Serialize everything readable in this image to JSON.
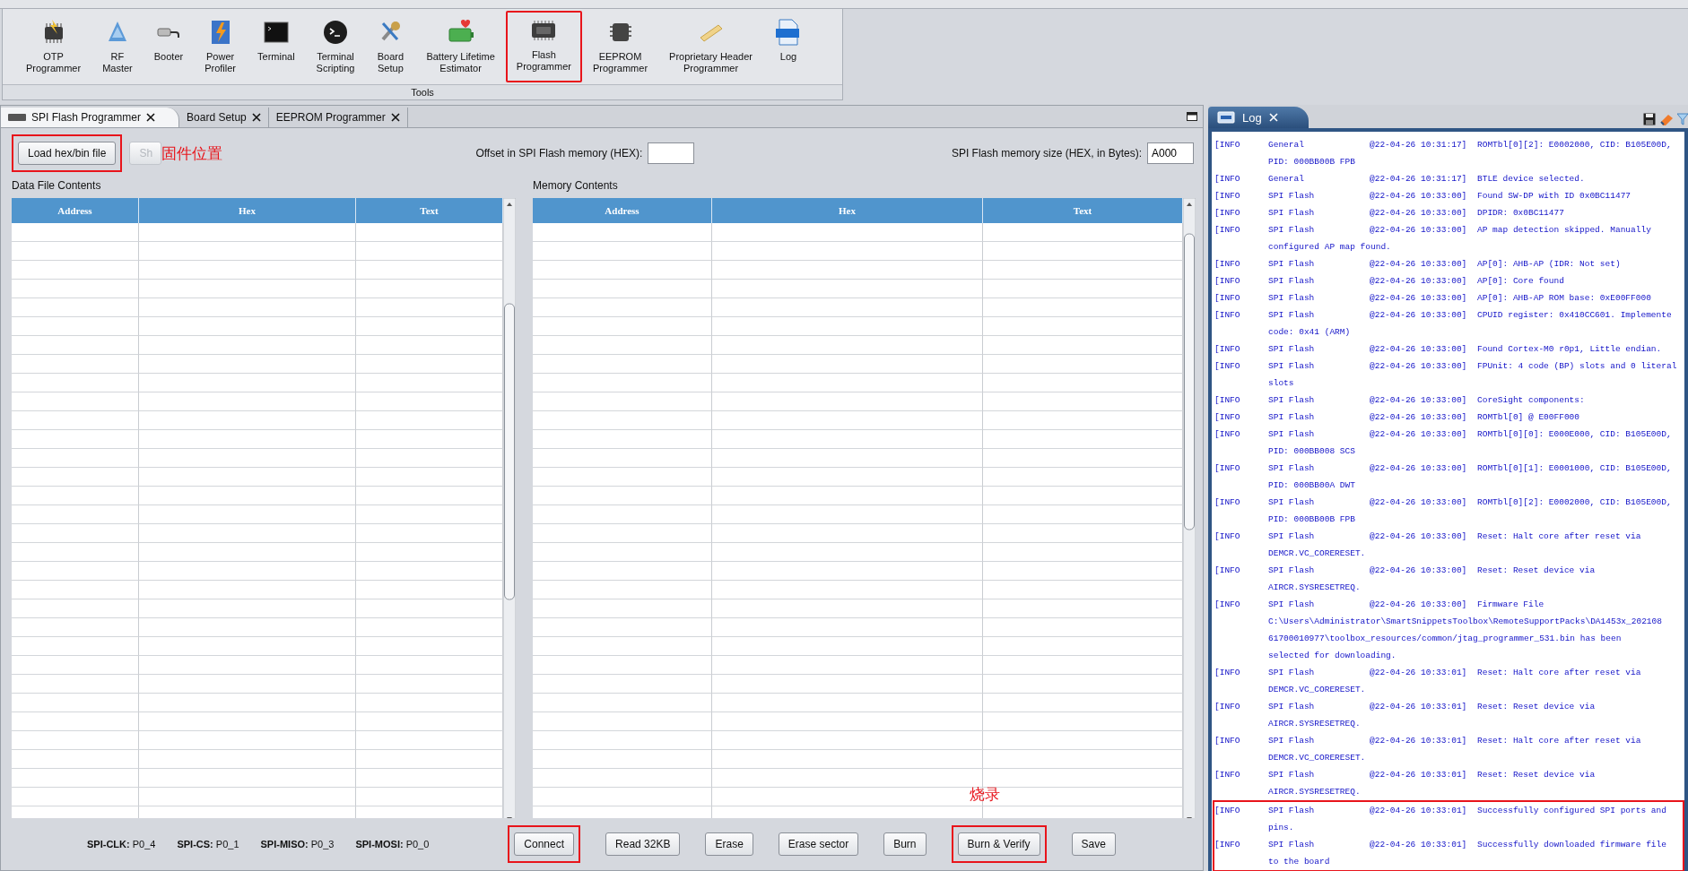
{
  "ribbon": {
    "items": [
      {
        "label": "OTP\nProgrammer",
        "highlighted": false
      },
      {
        "label": "RF\nMaster",
        "highlighted": false
      },
      {
        "label": "Booter",
        "highlighted": false
      },
      {
        "label": "Power\nProfiler",
        "highlighted": false
      },
      {
        "label": "Terminal",
        "highlighted": false
      },
      {
        "label": "Terminal\nScripting",
        "highlighted": false
      },
      {
        "label": "Board\nSetup",
        "highlighted": false
      },
      {
        "label": "Battery Lifetime\nEstimator",
        "highlighted": false
      },
      {
        "label": "Flash\nProgrammer",
        "highlighted": true
      },
      {
        "label": "EEPROM\nProgrammer",
        "highlighted": false
      },
      {
        "label": "Proprietary Header\nProgrammer",
        "highlighted": false
      },
      {
        "label": "Log",
        "highlighted": false
      }
    ],
    "caption": "Tools"
  },
  "tabs": [
    {
      "label": "SPI Flash Programmer",
      "selected": true
    },
    {
      "label": "Board Setup",
      "selected": false
    },
    {
      "label": "EEPROM Programmer",
      "selected": false
    }
  ],
  "load_button": {
    "label": "Load hex/bin file",
    "highlighted": true
  },
  "hidden_button": {
    "label": "Sh",
    "disabled": true
  },
  "load_note": "固件位置",
  "offset": {
    "label": "Offset in SPI Flash memory (HEX):"
  },
  "size": {
    "label": "SPI Flash memory size (HEX, in Bytes):",
    "value": "A000"
  },
  "data_file": {
    "title": "Data File Contents",
    "columns": [
      "Address",
      "Hex",
      "Text"
    ]
  },
  "memory": {
    "title": "Memory Contents",
    "columns": [
      "Address",
      "Hex",
      "Text"
    ]
  },
  "pins": [
    "**SPI-CLK:** P0_4",
    "**SPI-CS:** P0_1",
    "**SPI-MISO:** P0_3",
    "**SPI-MOSI:** P0_0"
  ],
  "buttons": [
    {
      "label": "Connect",
      "highlighted": true
    },
    {
      "label": "Read 32KB",
      "highlighted": false
    },
    {
      "label": "Erase",
      "highlighted": false
    },
    {
      "label": "Erase sector",
      "highlighted": false
    },
    {
      "label": "Burn",
      "highlighted": false
    },
    {
      "label": "Burn & Verify",
      "highlighted": true,
      "note": "烧录"
    },
    {
      "label": "Save",
      "highlighted": false
    }
  ],
  "log": {
    "title": "Log",
    "entries": [
      {
        "level": "[INFO",
        "source": "General",
        "time": "@22-04-26 10:31:17]",
        "lines": [
          "ROMTbl[0][2]: E0002000, CID: B105E00D,",
          "PID: 000BB00B FPB"
        ],
        "highlighted": false
      },
      {
        "level": "[INFO",
        "source": "General",
        "time": "@22-04-26 10:31:17]",
        "lines": [
          "BTLE device selected."
        ],
        "highlighted": false
      },
      {
        "level": "[INFO",
        "source": "SPI Flash",
        "time": "@22-04-26 10:33:00]",
        "lines": [
          "Found SW-DP with ID 0x0BC11477"
        ],
        "highlighted": false
      },
      {
        "level": "[INFO",
        "source": "SPI Flash",
        "time": "@22-04-26 10:33:00]",
        "lines": [
          "DPIDR: 0x0BC11477"
        ],
        "highlighted": false
      },
      {
        "level": "[INFO",
        "source": "SPI Flash",
        "time": "@22-04-26 10:33:00]",
        "lines": [
          "AP map detection skipped. Manually",
          "configured AP map found."
        ],
        "highlighted": false
      },
      {
        "level": "[INFO",
        "source": "SPI Flash",
        "time": "@22-04-26 10:33:00]",
        "lines": [
          "AP[0]: AHB-AP (IDR: Not set)"
        ],
        "highlighted": false
      },
      {
        "level": "[INFO",
        "source": "SPI Flash",
        "time": "@22-04-26 10:33:00]",
        "lines": [
          "AP[0]: Core found"
        ],
        "highlighted": false
      },
      {
        "level": "[INFO",
        "source": "SPI Flash",
        "time": "@22-04-26 10:33:00]",
        "lines": [
          "AP[0]: AHB-AP ROM base: 0xE00FF000"
        ],
        "highlighted": false
      },
      {
        "level": "[INFO",
        "source": "SPI Flash",
        "time": "@22-04-26 10:33:00]",
        "lines": [
          "CPUID register: 0x410CC601. Implemente",
          "code: 0x41 (ARM)"
        ],
        "highlighted": false
      },
      {
        "level": "[INFO",
        "source": "SPI Flash",
        "time": "@22-04-26 10:33:00]",
        "lines": [
          "Found Cortex-M0 r0p1, Little endian."
        ],
        "highlighted": false
      },
      {
        "level": "[INFO",
        "source": "SPI Flash",
        "time": "@22-04-26 10:33:00]",
        "lines": [
          "FPUnit: 4 code (BP) slots and 0 literal",
          "slots"
        ],
        "highlighted": false
      },
      {
        "level": "[INFO",
        "source": "SPI Flash",
        "time": "@22-04-26 10:33:00]",
        "lines": [
          "CoreSight components:"
        ],
        "highlighted": false
      },
      {
        "level": "[INFO",
        "source": "SPI Flash",
        "time": "@22-04-26 10:33:00]",
        "lines": [
          "ROMTbl[0] @ E00FF000"
        ],
        "highlighted": false
      },
      {
        "level": "[INFO",
        "source": "SPI Flash",
        "time": "@22-04-26 10:33:00]",
        "lines": [
          "ROMTbl[0][0]: E000E000, CID: B105E00D,",
          "PID: 000BB008 SCS"
        ],
        "highlighted": false
      },
      {
        "level": "[INFO",
        "source": "SPI Flash",
        "time": "@22-04-26 10:33:00]",
        "lines": [
          "ROMTbl[0][1]: E0001000, CID: B105E00D,",
          "PID: 000BB00A DWT"
        ],
        "highlighted": false
      },
      {
        "level": "[INFO",
        "source": "SPI Flash",
        "time": "@22-04-26 10:33:00]",
        "lines": [
          "ROMTbl[0][2]: E0002000, CID: B105E00D,",
          "PID: 000BB00B FPB"
        ],
        "highlighted": false
      },
      {
        "level": "[INFO",
        "source": "SPI Flash",
        "time": "@22-04-26 10:33:00]",
        "lines": [
          "Reset: Halt core after reset via",
          "DEMCR.VC_CORERESET."
        ],
        "highlighted": false
      },
      {
        "level": "[INFO",
        "source": "SPI Flash",
        "time": "@22-04-26 10:33:00]",
        "lines": [
          "Reset: Reset device via",
          "AIRCR.SYSRESETREQ."
        ],
        "highlighted": false
      },
      {
        "level": "[INFO",
        "source": "SPI Flash",
        "time": "@22-04-26 10:33:00]",
        "lines": [
          "Firmware File",
          "C:\\Users\\Administrator\\SmartSnippetsToolbox\\RemoteSupportPacks\\DA1453x_202108",
          "61700010977\\toolbox_resources/common/jtag_programmer_531.bin has been",
          "selected for downloading."
        ],
        "highlighted": false
      },
      {
        "level": "[INFO",
        "source": "SPI Flash",
        "time": "@22-04-26 10:33:01]",
        "lines": [
          "Reset: Halt core after reset via",
          "DEMCR.VC_CORERESET."
        ],
        "highlighted": false
      },
      {
        "level": "[INFO",
        "source": "SPI Flash",
        "time": "@22-04-26 10:33:01]",
        "lines": [
          "Reset: Reset device via",
          "AIRCR.SYSRESETREQ."
        ],
        "highlighted": false
      },
      {
        "level": "[INFO",
        "source": "SPI Flash",
        "time": "@22-04-26 10:33:01]",
        "lines": [
          "Reset: Halt core after reset via",
          "DEMCR.VC_CORERESET."
        ],
        "highlighted": false
      },
      {
        "level": "[INFO",
        "source": "SPI Flash",
        "time": "@22-04-26 10:33:01]",
        "lines": [
          "Reset: Reset device via",
          "AIRCR.SYSRESETREQ."
        ],
        "highlighted": false
      },
      {
        "level": "[INFO",
        "source": "SPI Flash",
        "time": "@22-04-26 10:33:01]",
        "lines": [
          "Successfully configured SPI ports and",
          "pins."
        ],
        "highlighted": true
      },
      {
        "level": "[INFO",
        "source": "SPI Flash",
        "time": "@22-04-26 10:33:01]",
        "lines": [
          "Successfully downloaded firmware file",
          "to the board"
        ],
        "highlighted": true
      }
    ]
  }
}
